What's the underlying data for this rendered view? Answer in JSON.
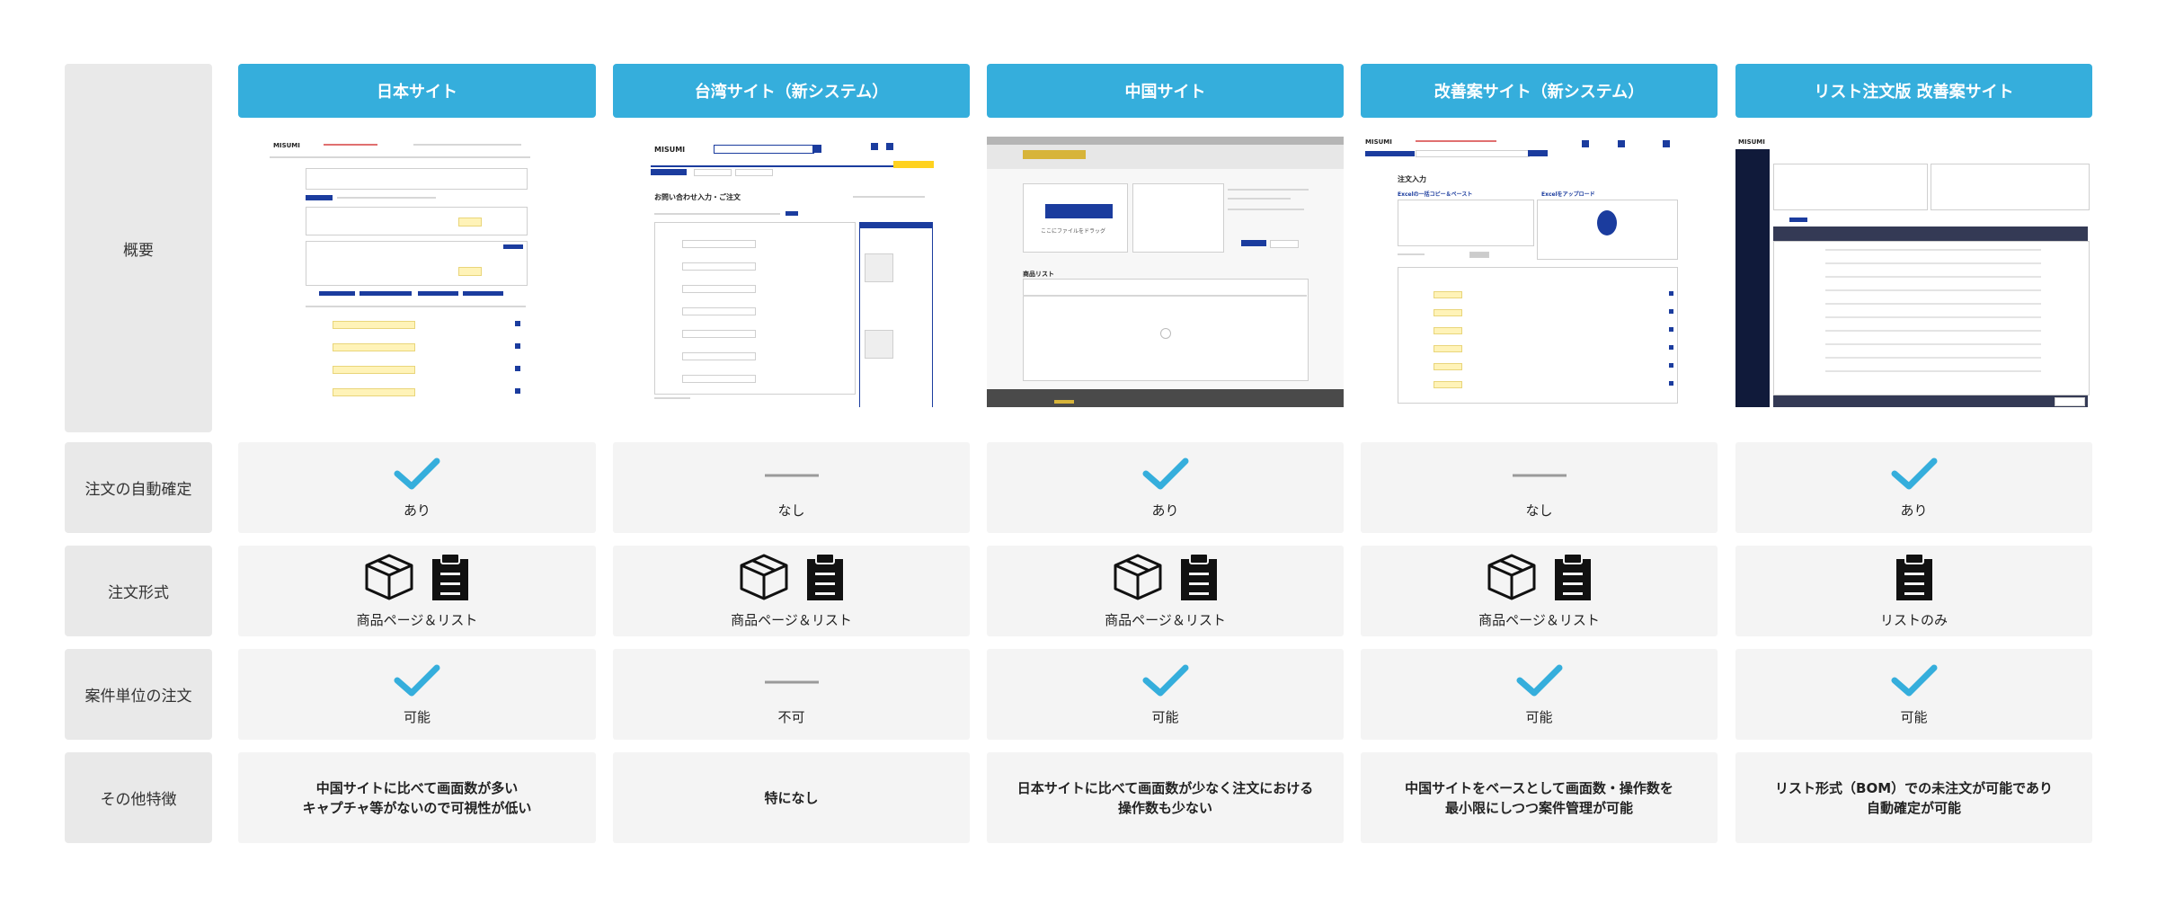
{
  "row_labels": {
    "overview": "概要",
    "auto_confirm": "注文の自動確定",
    "order_format": "注文形式",
    "project_order": "案件単位の注文",
    "other": "その他特徴"
  },
  "columns": [
    {
      "title": "日本サイト",
      "auto_confirm": "あり",
      "order_format": "商品ページ＆リスト",
      "project_order": "可能",
      "other_line1": "中国サイトに比べて画面数が多い",
      "other_line2": "キャプチャ等がないので可視性が低い"
    },
    {
      "title": "台湾サイト（新システム）",
      "auto_confirm": "なし",
      "order_format": "商品ページ＆リスト",
      "project_order": "不可",
      "other_line1": "特になし",
      "other_line2": ""
    },
    {
      "title": "中国サイト",
      "auto_confirm": "あり",
      "order_format": "商品ページ＆リスト",
      "project_order": "可能",
      "other_line1": "日本サイトに比べて画面数が少なく注文における",
      "other_line2": "操作数も少ない"
    },
    {
      "title": "改善案サイト（新システム）",
      "auto_confirm": "なし",
      "order_format": "商品ページ＆リスト",
      "project_order": "可能",
      "other_line1": "中国サイトをベースとして画面数・操作数を",
      "other_line2": "最小限にしつつ案件管理が可能"
    },
    {
      "title": "リスト注文版 改善案サイト",
      "auto_confirm": "あり",
      "order_format": "リストのみ",
      "project_order": "可能",
      "other_line1": "リスト形式（BOM）での未注文が可能であり",
      "other_line2": "自動確定が可能"
    }
  ],
  "thumbnails": {
    "japan": {
      "brand": "MISUMI"
    },
    "taiwan": {
      "brand": "MISUMI",
      "heading": "お問い合わせ入力・ご注文"
    },
    "china": {
      "list_title": "商品リスト",
      "upload_label": "ここにファイルをドラッグ"
    },
    "proposal": {
      "brand": "MISUMI",
      "heading": "注文入力",
      "paste_label": "Excelの一括コピー＆ペースト",
      "upload_label": "Excelをアップロード"
    },
    "list_version": {
      "brand": "MISUMI"
    }
  },
  "icons": {
    "check": "checkmark-icon",
    "dash": "dash-icon",
    "product_page": "box-icon",
    "list": "clipboard-icon"
  },
  "colors": {
    "header_bg": "#35aedc",
    "check": "#35aedc",
    "label_bg": "#e9e9e9",
    "cell_bg": "#f4f4f4"
  }
}
